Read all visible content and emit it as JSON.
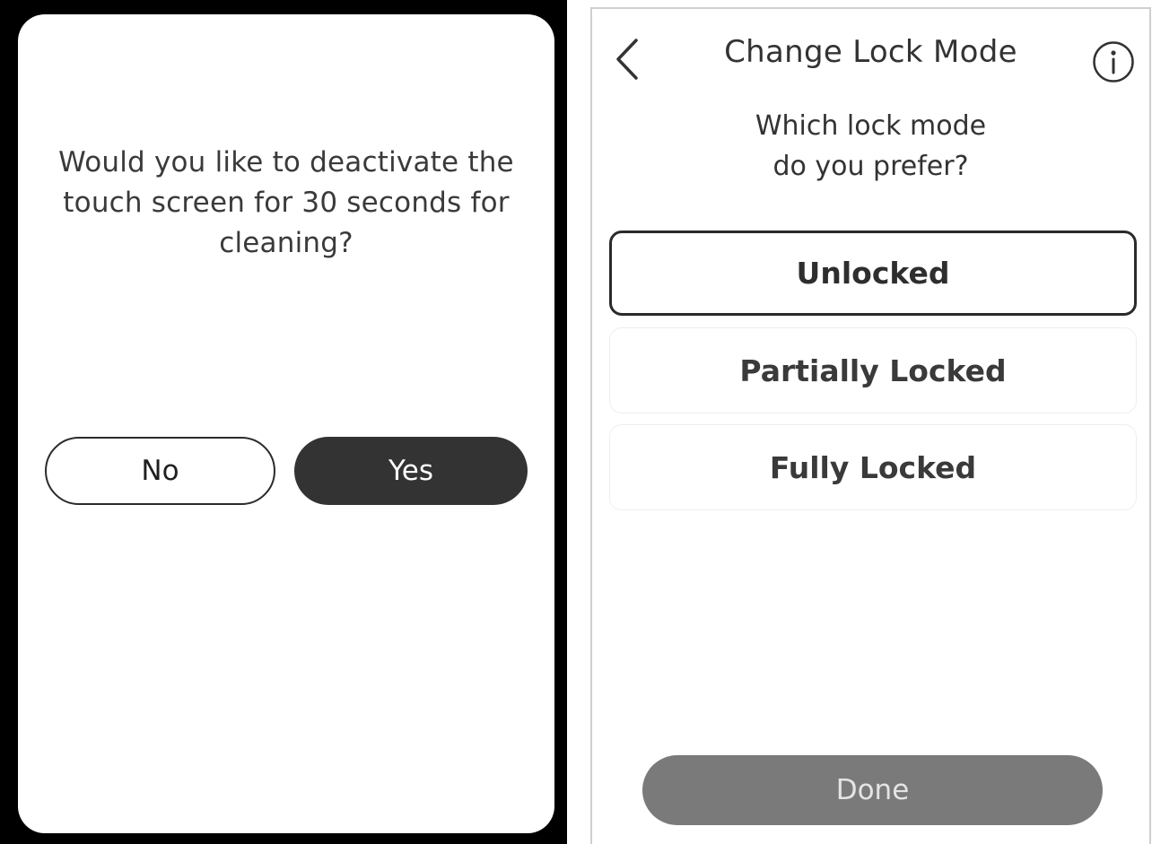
{
  "cleaning_dialog": {
    "message": "Would you like to deactivate the touch screen for 30 seconds for cleaning?",
    "no_label": "No",
    "yes_label": "Yes"
  },
  "lock_mode_screen": {
    "title": "Change Lock Mode",
    "subtitle_line1": "Which lock mode",
    "subtitle_line2": "do you prefer?",
    "options": [
      {
        "label": "Unlocked",
        "selected": true
      },
      {
        "label": "Partially Locked",
        "selected": false
      },
      {
        "label": "Fully Locked",
        "selected": false
      }
    ],
    "done_label": "Done",
    "icons": {
      "back": "chevron-left-icon",
      "info": "info-icon"
    }
  },
  "colors": {
    "frame_black": "#000000",
    "yes_button": "#333333",
    "done_button": "#7a7a7a",
    "text_dark": "#333333"
  }
}
